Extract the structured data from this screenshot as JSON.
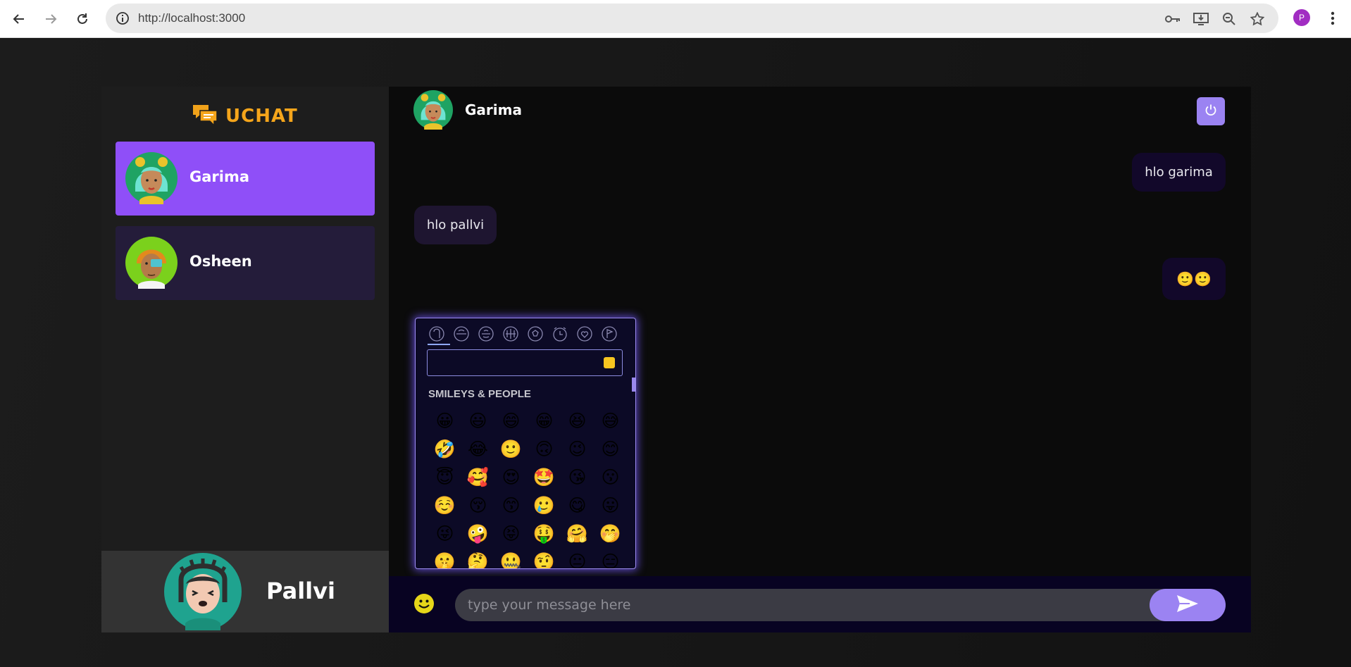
{
  "browser": {
    "url": "http://localhost:3000",
    "profile_initial": "P"
  },
  "app": {
    "brand": "UCHAT",
    "accent_color": "#9b83f2",
    "selected_contact_color": "#8f4ff8",
    "brand_color": "#f5a51b"
  },
  "contacts": [
    {
      "name": "Garima",
      "selected": true
    },
    {
      "name": "Osheen",
      "selected": false
    }
  ],
  "current_user": {
    "name": "Pallvi"
  },
  "chat": {
    "header_name": "Garima",
    "messages": [
      {
        "text": "hlo garima",
        "direction": "sent"
      },
      {
        "text": "hlo pallvi",
        "direction": "received"
      },
      {
        "text": "🙂🙂",
        "direction": "sent"
      }
    ],
    "input_placeholder": "type your message here"
  },
  "emoji_picker": {
    "category_label": "SMILEYS & PEOPLE",
    "categories": [
      "smileys-people",
      "animals-nature",
      "food-drink",
      "travel-places",
      "activities",
      "objects",
      "symbols",
      "flags"
    ],
    "emojis": [
      "😀",
      "😃",
      "😄",
      "😁",
      "😆",
      "😅",
      "🤣",
      "😂",
      "🙂",
      "🙃",
      "😉",
      "😊",
      "😇",
      "🥰",
      "😍",
      "🤩",
      "😘",
      "😗",
      "☺️",
      "😚",
      "😙",
      "🥲",
      "😋",
      "😛",
      "😜",
      "🤪",
      "😝",
      "🤑",
      "🤗",
      "🤭",
      "🤫",
      "🤔",
      "🤐",
      "🤨",
      "😐",
      "😑"
    ]
  }
}
